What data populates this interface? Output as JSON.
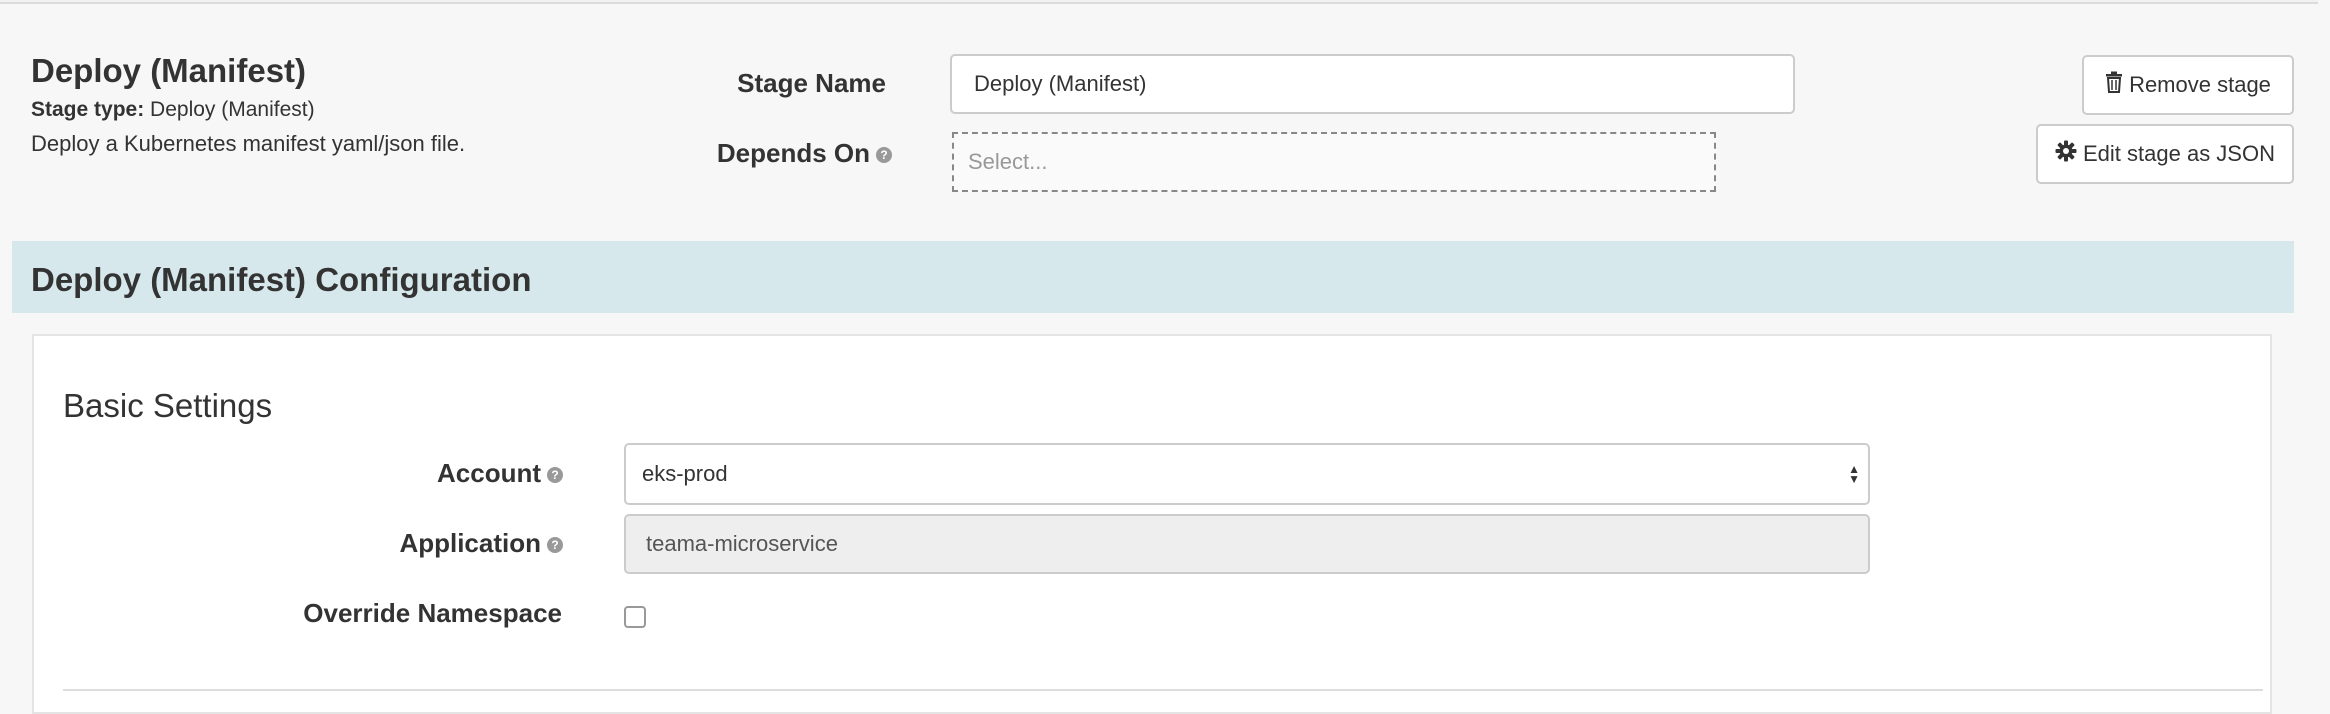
{
  "header": {
    "title": "Deploy (Manifest)",
    "stage_type_label": "Stage type:",
    "stage_type_value": "Deploy (Manifest)",
    "description": "Deploy a Kubernetes manifest yaml/json file."
  },
  "stage_name": {
    "label": "Stage Name",
    "value": "Deploy (Manifest)"
  },
  "depends_on": {
    "label": "Depends On",
    "placeholder": "Select..."
  },
  "actions": {
    "remove_label": "Remove stage",
    "edit_json_label": "Edit stage as JSON"
  },
  "config": {
    "title": "Deploy (Manifest) Configuration"
  },
  "basic_settings": {
    "title": "Basic Settings",
    "account": {
      "label": "Account",
      "value": "eks-prod"
    },
    "application": {
      "label": "Application",
      "value": "teama-microservice"
    },
    "override_namespace": {
      "label": "Override Namespace",
      "checked": false
    }
  },
  "colors": {
    "config_band": "#d6e8ec",
    "page_bg": "#f7f7f7"
  },
  "icons": {
    "remove": "trash-icon",
    "edit_json": "gear-icon",
    "help": "question-circle-icon"
  }
}
